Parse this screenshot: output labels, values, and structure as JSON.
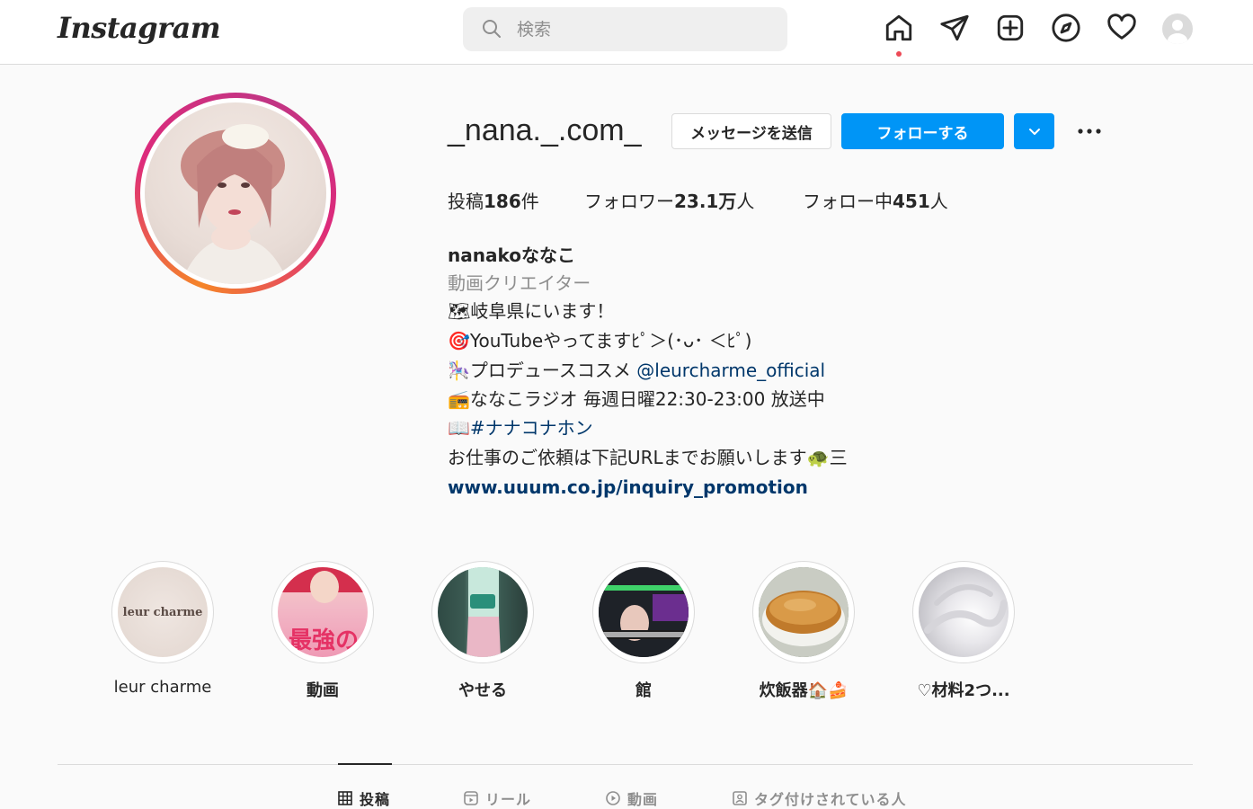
{
  "header": {
    "logo_text": "Instagram",
    "search": {
      "placeholder": "検索"
    }
  },
  "profile": {
    "username": "_nana._.com_",
    "buttons": {
      "message": "メッセージを送信",
      "follow": "フォローする"
    },
    "stats": {
      "posts_label": "投稿",
      "posts_value": "186",
      "posts_unit": "件",
      "followers_label": "フォロワー",
      "followers_value": "23.1万",
      "followers_unit": "人",
      "following_label": "フォロー中",
      "following_value": "451",
      "following_unit": "人"
    },
    "bio": {
      "name": "nanakoななこ",
      "category": "動画クリエイター",
      "line1": "🗺岐阜県にいます！",
      "line2": "🎯YouTubeやってますﾋﾟ＞(･ᴗ･ ＜ﾋﾟ)",
      "line3_prefix": "🎠プロデュースコスメ ",
      "line3_mention": "@leurcharme_official",
      "line4": "📻ななこラジオ 毎週日曜22:30-23:00 放送中",
      "line5_prefix": "📖",
      "line5_hashtag": "#ナナコナホン",
      "line6": "お仕事のご依頼は下記URLまでお願いします🐢三",
      "url": "www.uuum.co.jp/inquiry_promotion"
    }
  },
  "highlights": [
    {
      "label": "leur charme",
      "cover_text": "leur charme"
    },
    {
      "label": "動画",
      "cover_text": "最強の"
    },
    {
      "label": "やせる"
    },
    {
      "label": "館"
    },
    {
      "label": "炊飯器🏠🍰"
    },
    {
      "label": "♡材料2つ..."
    }
  ],
  "tabs": [
    {
      "label": "投稿",
      "active": true
    },
    {
      "label": "リール",
      "active": false
    },
    {
      "label": "動画",
      "active": false
    },
    {
      "label": "タグ付けされている人",
      "active": false
    }
  ],
  "colors": {
    "accent": "#0095f6",
    "link": "#00376b",
    "notification_dot": "#ed4956"
  }
}
